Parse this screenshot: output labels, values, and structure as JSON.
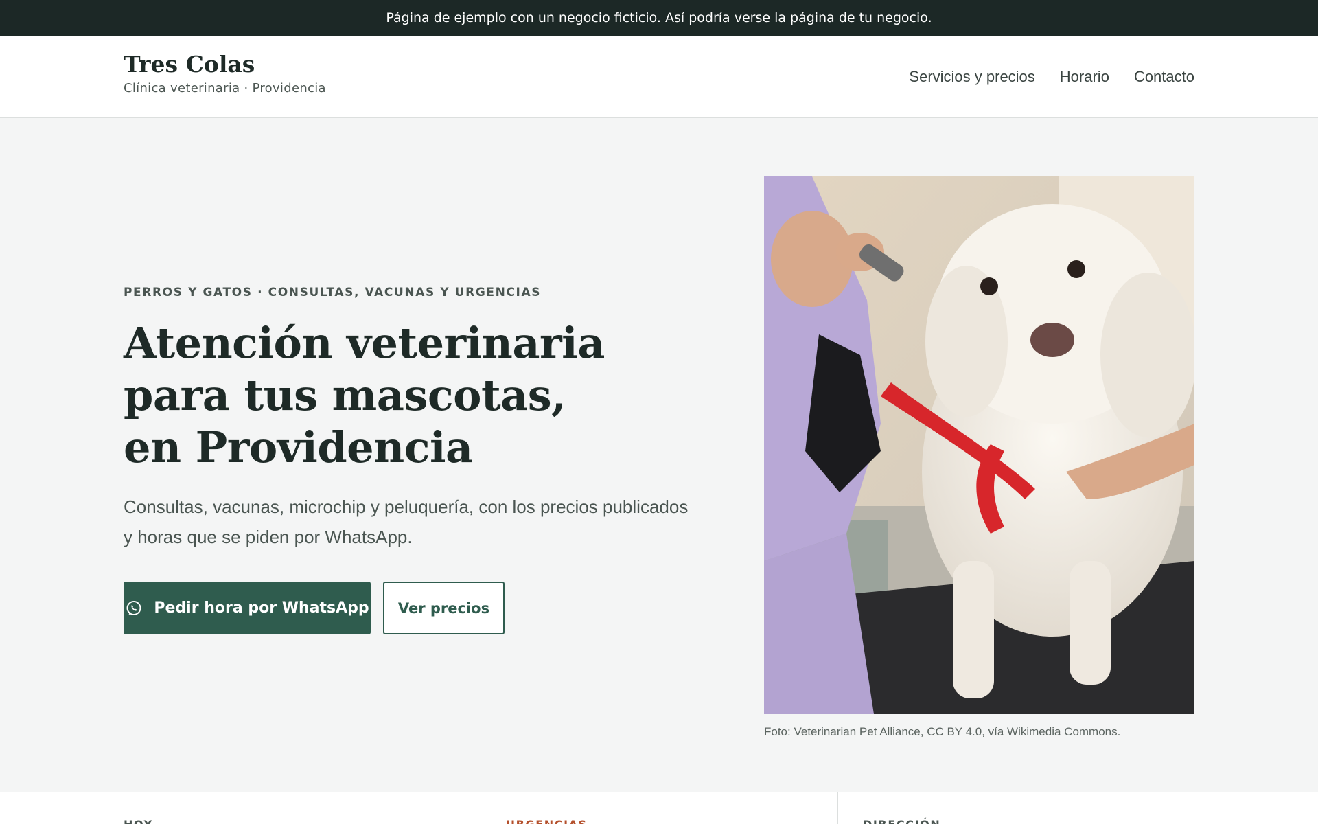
{
  "notice": {
    "text": "Página de ejemplo con un negocio ficticio. Así podría verse la página de tu negocio."
  },
  "header": {
    "brand_name": "Tres Colas",
    "brand_subtitle": "Clínica veterinaria · Providencia",
    "nav": [
      {
        "label": "Servicios y precios"
      },
      {
        "label": "Horario"
      },
      {
        "label": "Contacto"
      }
    ]
  },
  "hero": {
    "eyebrow": "PERROS Y GATOS · CONSULTAS, VACUNAS Y URGENCIAS",
    "title_lines": [
      "Atención veterinaria",
      "para tus mascotas,",
      "en Providencia"
    ],
    "text": "Consultas, vacunas, microchip y peluquería, con los precios publicados y horas que se piden por WhatsApp.",
    "primary_button": {
      "label": "Pedir hora por WhatsApp",
      "icon": "whatsapp-icon"
    },
    "secondary_button": {
      "label": "Ver precios"
    }
  },
  "photo": {
    "caption": "Foto: Veterinarian Pet Alliance, CC BY 4.0, vía Wikimedia Commons."
  },
  "info": [
    {
      "label": "HOY"
    },
    {
      "label": "URGENCIAS"
    },
    {
      "label": "DIRECCIÓN"
    }
  ],
  "colors": {
    "brand_green": "#2f5c4e",
    "banner_dark": "#1c2826",
    "urgent_accent": "#b4502c"
  }
}
